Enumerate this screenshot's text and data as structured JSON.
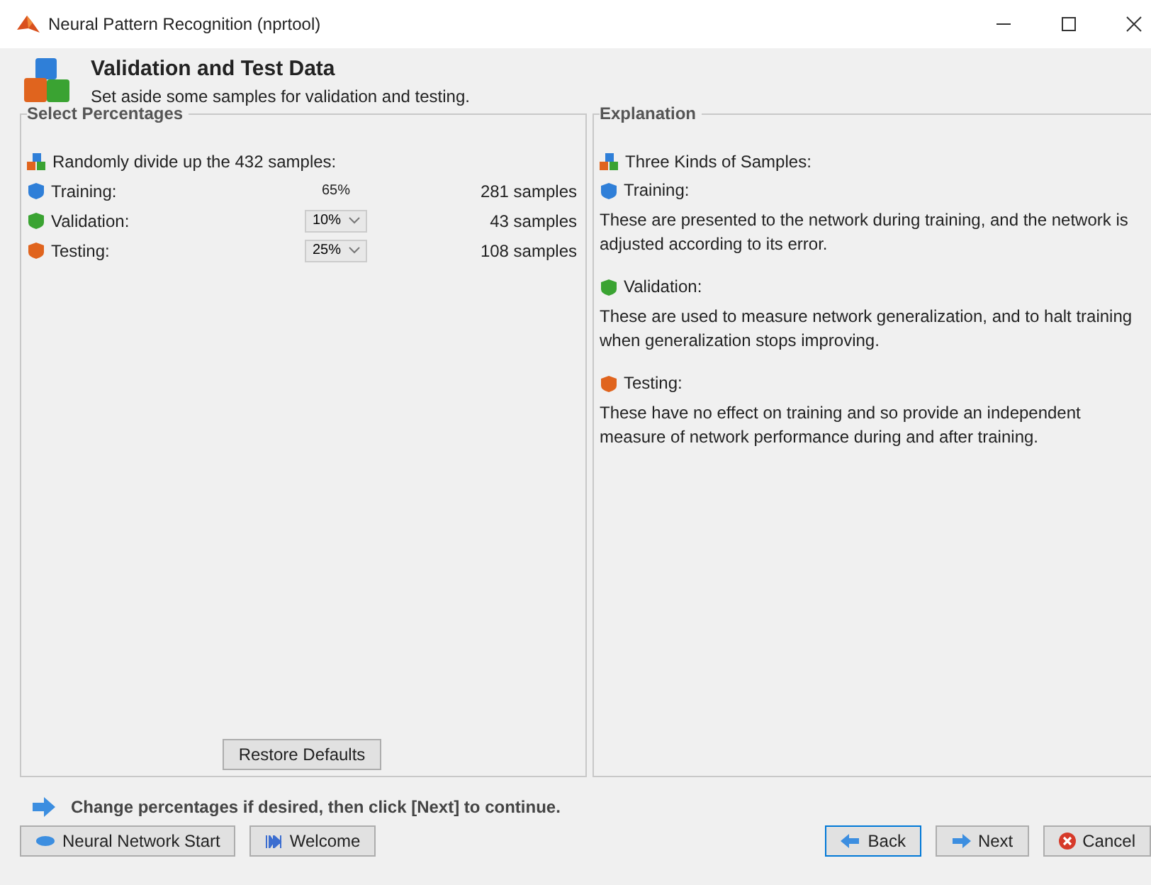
{
  "window": {
    "title": "Neural Pattern Recognition (nprtool)"
  },
  "header": {
    "title": "Validation and Test Data",
    "subtitle": "Set aside some samples for validation and testing."
  },
  "select_panel": {
    "title": "Select Percentages",
    "intro": "Randomly divide up the 432 samples:",
    "rows": [
      {
        "label": "Training:",
        "kind": "fixed",
        "percent": "65%",
        "samples": "281 samples",
        "color": "#2f7fd8"
      },
      {
        "label": "Validation:",
        "kind": "dropdown",
        "percent": "10%",
        "samples": "43 samples",
        "color": "#3aa332"
      },
      {
        "label": "Testing:",
        "kind": "dropdown",
        "percent": "25%",
        "samples": "108 samples",
        "color": "#e0641e"
      }
    ],
    "restore_button": "Restore Defaults"
  },
  "explanation_panel": {
    "title": "Explanation",
    "intro": "Three Kinds of Samples:",
    "items": [
      {
        "heading": "Training:",
        "text": "These are presented to the network during training, and the network is adjusted according to its error.",
        "color": "#2f7fd8"
      },
      {
        "heading": "Validation:",
        "text": "These are used to measure network generalization, and to halt training when generalization stops improving.",
        "color": "#3aa332"
      },
      {
        "heading": "Testing:",
        "text": "These have no effect on training and so provide an independent measure of network performance during and after training.",
        "color": "#e0641e"
      }
    ]
  },
  "hint": "Change percentages if desired, then click [Next] to continue.",
  "buttons_left": [
    {
      "label": "Neural Network Start",
      "kind": "start"
    },
    {
      "label": "Welcome",
      "kind": "welcome"
    }
  ],
  "buttons_right": [
    {
      "label": "Back",
      "kind": "back",
      "selected": true
    },
    {
      "label": "Next",
      "kind": "next",
      "selected": false
    },
    {
      "label": "Cancel",
      "kind": "cancel",
      "selected": false
    }
  ]
}
